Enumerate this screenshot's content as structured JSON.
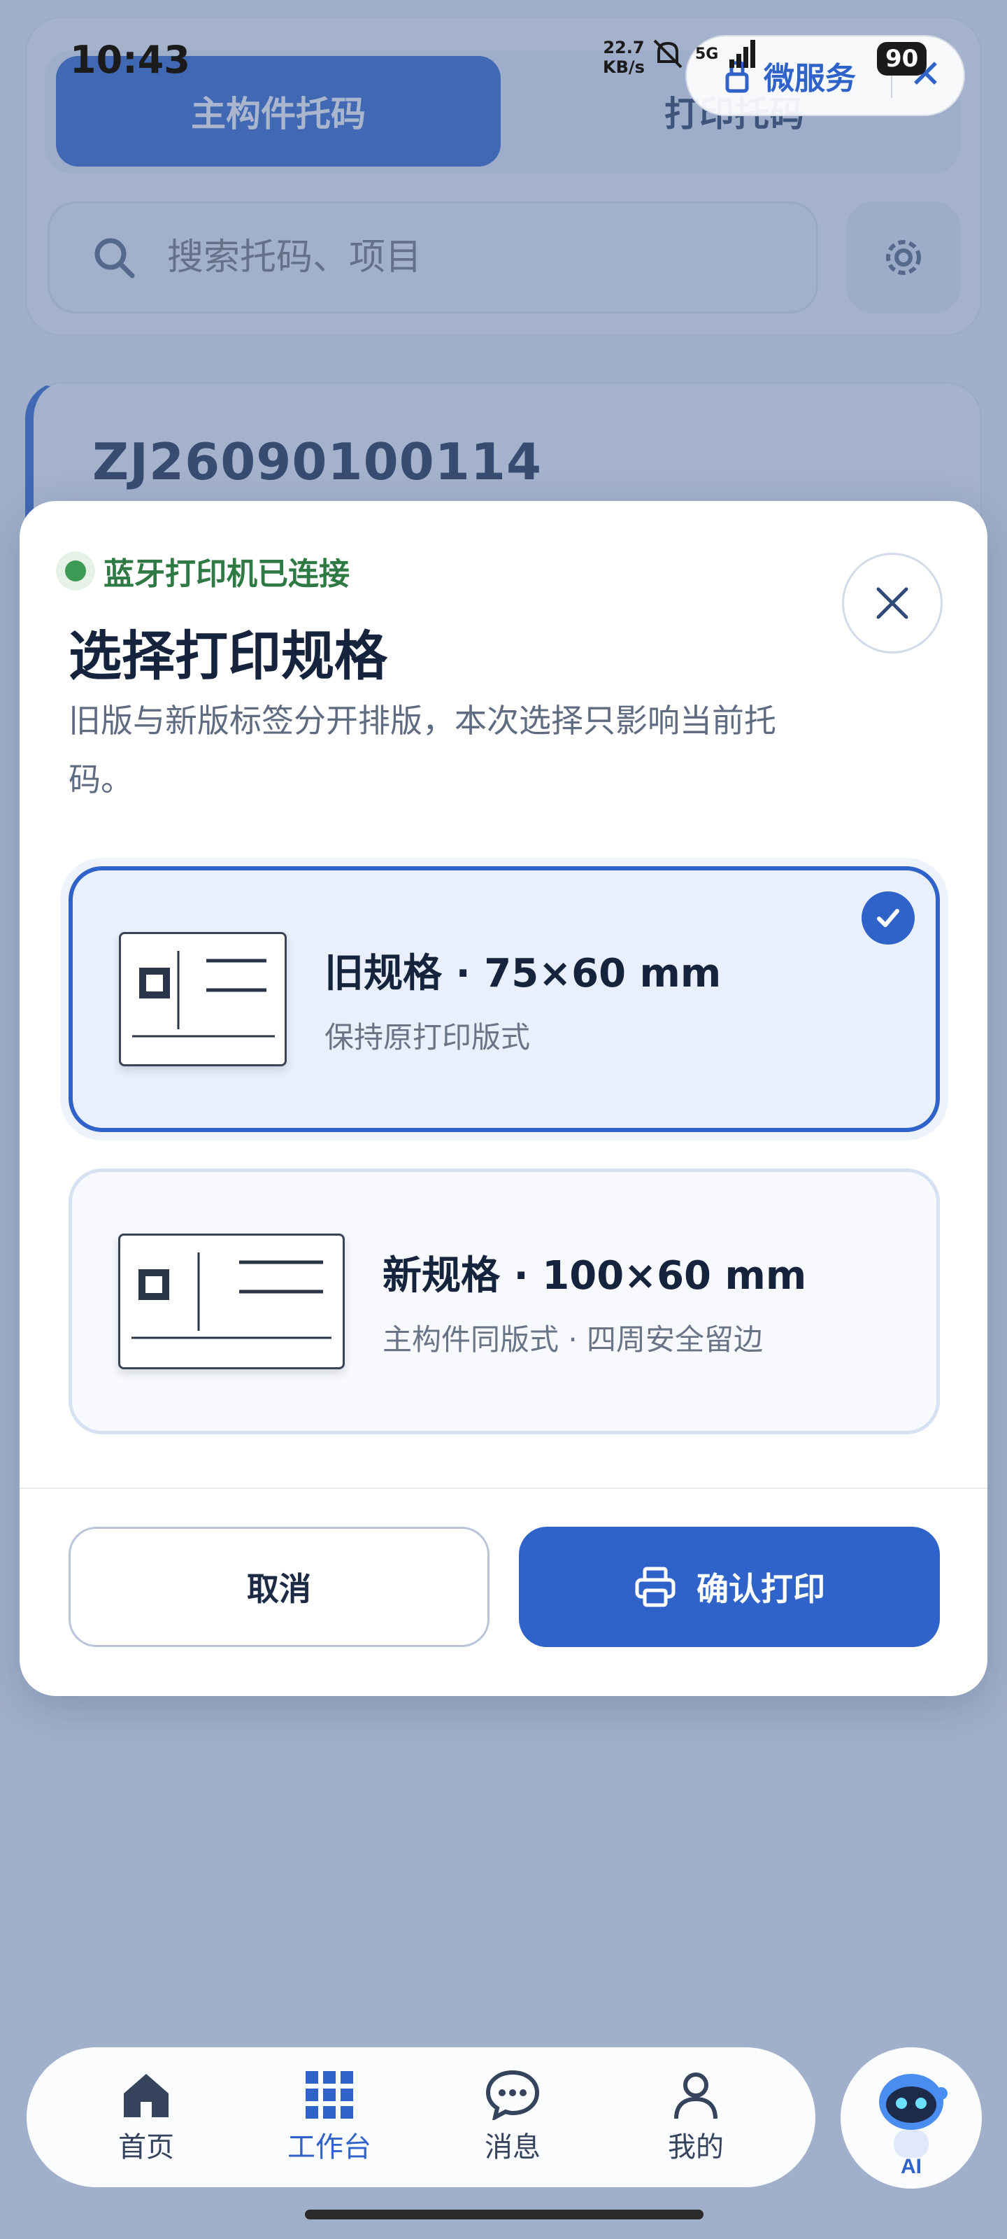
{
  "status_bar": {
    "time": "10:43",
    "net_speed_value": "22.7",
    "net_speed_unit": "KB/s",
    "signal_1": "5G",
    "signal_2": "5G",
    "battery": "90"
  },
  "mini_program": {
    "label": "微服务",
    "close_symbol": "✕"
  },
  "background": {
    "tabs": [
      "主构件托码",
      "打印托码"
    ],
    "active_tab_index": 0,
    "search_placeholder": "搜索托码、项目",
    "record_code": "ZJ26090100114"
  },
  "modal": {
    "connection_status": "蓝牙打印机已连接",
    "title": "选择打印规格",
    "description": "旧版与新版标签分开排版，本次选择只影响当前托码。",
    "options": [
      {
        "title": "旧规格 · 75×60 mm",
        "subtitle": "保持原打印版式",
        "selected": true
      },
      {
        "title": "新规格 · 100×60 mm",
        "subtitle": "主构件同版式 · 四周安全留边",
        "selected": false
      }
    ],
    "cancel_label": "取消",
    "confirm_label": "确认打印"
  },
  "tabbar": {
    "items": [
      {
        "label": "首页",
        "icon": "home-icon",
        "active": false
      },
      {
        "label": "工作台",
        "icon": "grid-icon",
        "active": true
      },
      {
        "label": "消息",
        "icon": "chat-icon",
        "active": false
      },
      {
        "label": "我的",
        "icon": "user-icon",
        "active": false
      }
    ],
    "ai_label": "AI"
  },
  "colors": {
    "primary": "#2f63c9",
    "success": "#3c9a55",
    "text_dark": "#16233c"
  }
}
